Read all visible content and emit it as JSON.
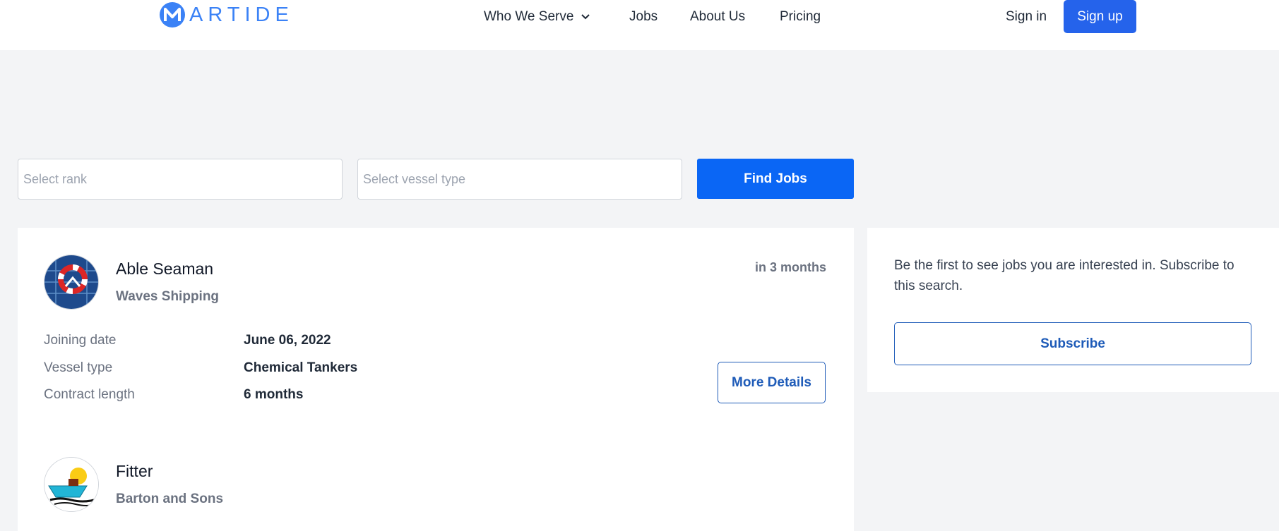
{
  "header": {
    "logo_text": "ARTIDE",
    "nav": {
      "who_we_serve": "Who We Serve",
      "jobs": "Jobs",
      "about_us": "About Us",
      "pricing": "Pricing"
    },
    "sign_in": "Sign in",
    "sign_up": "Sign up",
    "accent_color": "#2563eb"
  },
  "search": {
    "rank_placeholder": "Select rank",
    "vessel_placeholder": "Select vessel type",
    "find_button": "Find Jobs"
  },
  "jobs": [
    {
      "title": "Able Seaman",
      "company": "Waves Shipping",
      "when": "in 3 months",
      "details": [
        {
          "label": "Joining date",
          "value": "June 06, 2022"
        },
        {
          "label": "Vessel type",
          "value": "Chemical Tankers"
        },
        {
          "label": "Contract length",
          "value": "6 months"
        }
      ],
      "more_button": "More Details",
      "logo_icon": "lifebuoy-icon"
    },
    {
      "title": "Fitter",
      "company": "Barton and Sons",
      "logo_icon": "ship-icon"
    }
  ],
  "subscribe": {
    "text": "Be the first to see jobs you are interested in. Subscribe to this search.",
    "button": "Subscribe"
  }
}
